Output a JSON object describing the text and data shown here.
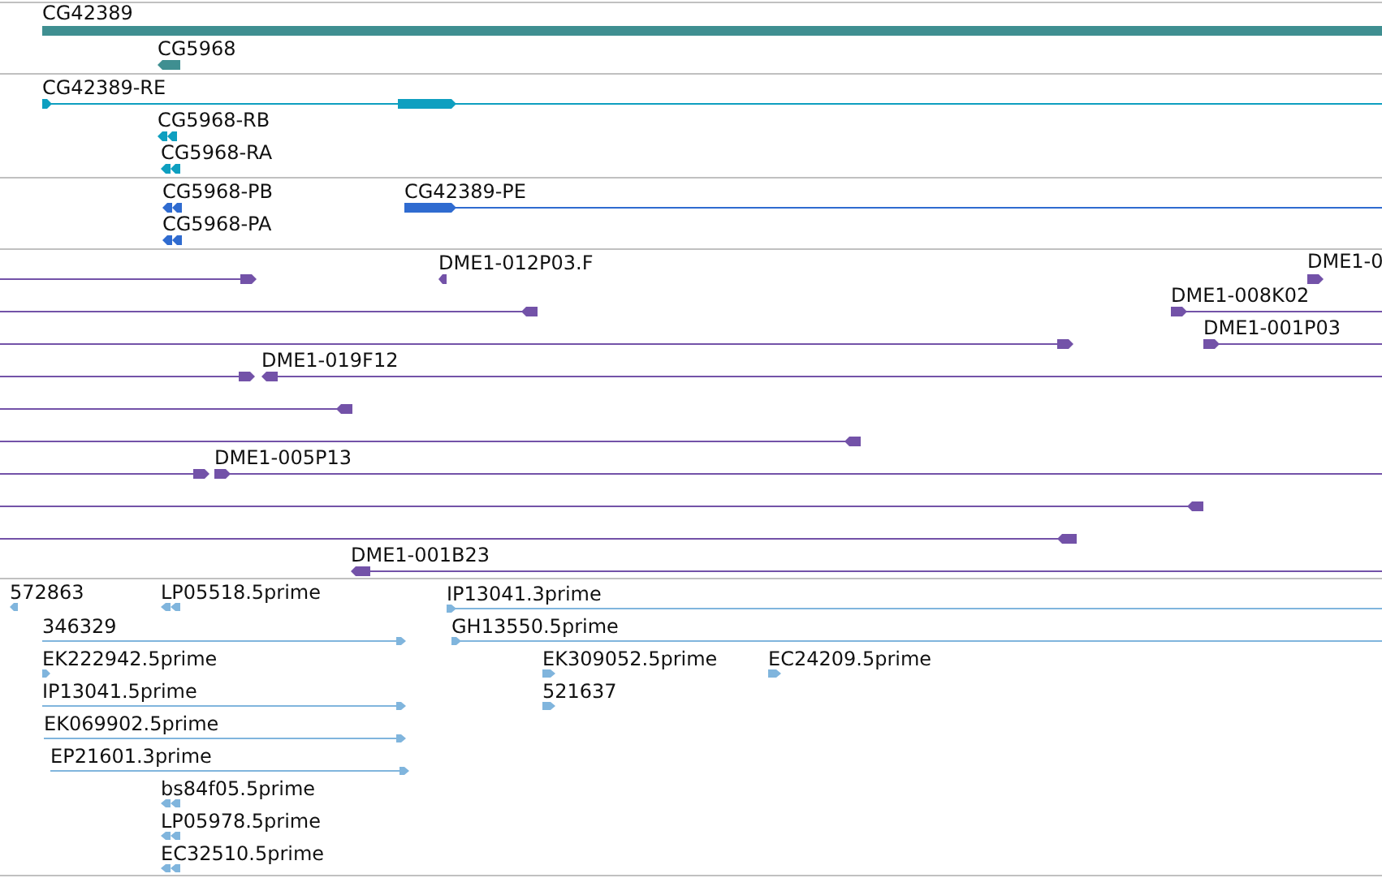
{
  "tracks": [
    {
      "color": "#3f8f91",
      "features": [
        {
          "kind": "gene",
          "label": "CG42389"
        },
        {
          "kind": "gene",
          "label": "CG5968",
          "reverse": true
        }
      ]
    },
    {
      "color": "#0e9fc0",
      "features": [
        {
          "kind": "transcript",
          "label": "CG42389-RE",
          "reverse": false
        },
        {
          "kind": "transcript",
          "label": "CG5968-RB",
          "reverse": true
        },
        {
          "kind": "transcript",
          "label": "CG5968-RA",
          "reverse": true
        }
      ]
    },
    {
      "color": "#2f6bd0",
      "features": [
        {
          "kind": "transcript",
          "label": "CG5968-PB",
          "reverse": true
        },
        {
          "kind": "transcript",
          "label": "CG42389-PE",
          "reverse": false
        },
        {
          "kind": "transcript",
          "label": "CG5968-PA",
          "reverse": true
        }
      ]
    },
    {
      "color": "#7352a8",
      "features": [
        {
          "kind": "alignment",
          "reverse": false
        },
        {
          "kind": "alignment",
          "label": "DME1-012P03.F",
          "reverse": true
        },
        {
          "kind": "alignment",
          "label": "DME1-0",
          "reverse": false
        },
        {
          "kind": "alignment",
          "reverse": true
        },
        {
          "kind": "alignment",
          "label": "DME1-008K02",
          "reverse": false
        },
        {
          "kind": "alignment",
          "reverse": false
        },
        {
          "kind": "alignment",
          "label": "DME1-001P03",
          "reverse": false
        },
        {
          "kind": "alignment",
          "reverse": false
        },
        {
          "kind": "alignment",
          "label": "DME1-019F12",
          "reverse": true
        },
        {
          "kind": "alignment",
          "reverse": true
        },
        {
          "kind": "alignment",
          "reverse": true
        },
        {
          "kind": "alignment",
          "reverse": false
        },
        {
          "kind": "alignment",
          "label": "DME1-005P13",
          "reverse": false
        },
        {
          "kind": "alignment",
          "reverse": true
        },
        {
          "kind": "alignment",
          "reverse": true
        },
        {
          "kind": "alignment",
          "label": "DME1-001B23",
          "reverse": true
        }
      ]
    },
    {
      "color": "#80b5dd",
      "features": [
        {
          "kind": "alignment",
          "label": "572863",
          "reverse": true
        },
        {
          "kind": "alignment",
          "label": "LP05518.5prime",
          "reverse": true
        },
        {
          "kind": "alignment",
          "label": "IP13041.3prime",
          "reverse": false
        },
        {
          "kind": "alignment",
          "label": "346329",
          "reverse": false
        },
        {
          "kind": "alignment",
          "label": "GH13550.5prime",
          "reverse": false
        },
        {
          "kind": "alignment",
          "label": "EK222942.5prime",
          "reverse": false
        },
        {
          "kind": "alignment",
          "label": "EK309052.5prime",
          "reverse": false
        },
        {
          "kind": "alignment",
          "label": "EC24209.5prime",
          "reverse": false
        },
        {
          "kind": "alignment",
          "label": "IP13041.5prime",
          "reverse": false
        },
        {
          "kind": "alignment",
          "label": "521637",
          "reverse": false
        },
        {
          "kind": "alignment",
          "label": "EK069902.5prime",
          "reverse": false
        },
        {
          "kind": "alignment",
          "label": "EP21601.3prime",
          "reverse": false
        },
        {
          "kind": "alignment",
          "label": "bs84f05.5prime",
          "reverse": true
        },
        {
          "kind": "alignment",
          "label": "LP05978.5prime",
          "reverse": true
        },
        {
          "kind": "alignment",
          "label": "EC32510.5prime",
          "reverse": true
        }
      ]
    }
  ]
}
